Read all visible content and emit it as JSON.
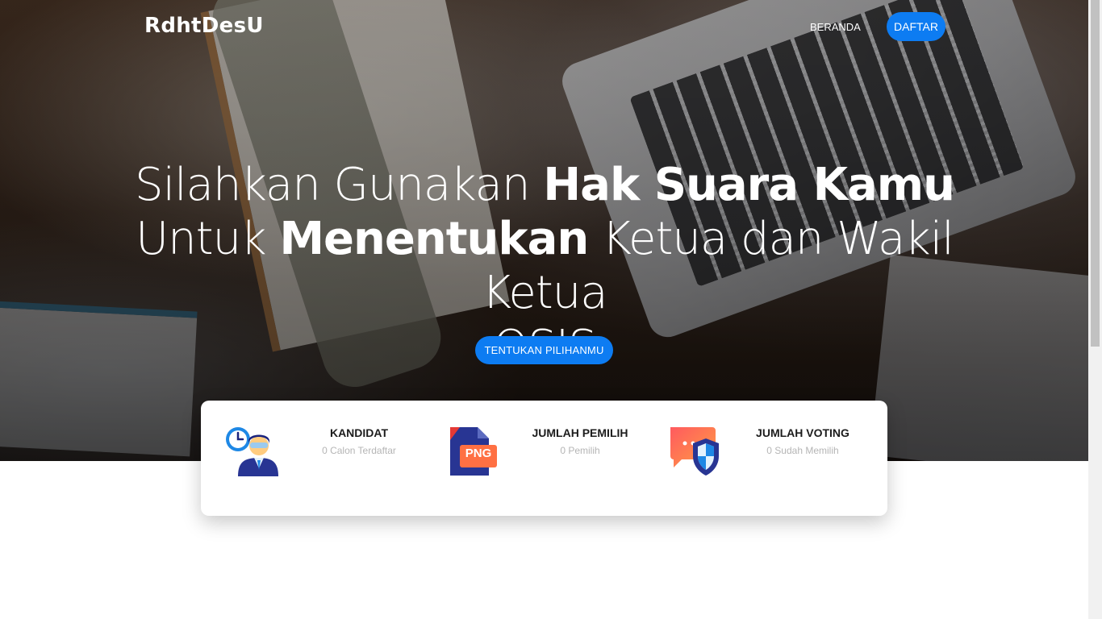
{
  "navbar": {
    "brand": "RdhtDesU",
    "home_label": "BERANDA",
    "register_label": "DAFTAR"
  },
  "hero": {
    "line1_light": "Silahkan Gunakan ",
    "line1_bold": "Hak Suara Kamu",
    "line2_light_a": "Untuk ",
    "line2_bold": "Menentukan",
    "line2_light_b": " Ketua dan Wakil Ketua",
    "line3": "OSIS",
    "cta_label": "TENTUKAN PILIHANMU"
  },
  "stats": [
    {
      "title": "KANDIDAT",
      "subtitle": "0 Calon Terdaftar",
      "icon": "candidate-icon"
    },
    {
      "title": "JUMLAH PEMILIH",
      "subtitle": "0 Pemilih",
      "icon": "png-file-icon",
      "icon_text": "PNG"
    },
    {
      "title": "JUMLAH VOTING",
      "subtitle": "0 Sudah Memilih",
      "icon": "chat-shield-icon"
    }
  ],
  "colors": {
    "primary": "#0d7cf2",
    "card_bg": "#ffffff",
    "subtitle": "#b5b5b5"
  }
}
